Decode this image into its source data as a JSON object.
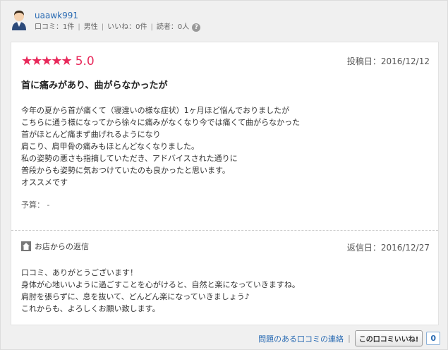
{
  "reviewer": {
    "name": "uaawk991",
    "stats": [
      "口コミ：1件",
      "男性",
      "いいね：0件",
      "読者：0人"
    ]
  },
  "review": {
    "stars": "★★★★★",
    "rating": "5.0",
    "post_date": "投稿日：2016/12/12",
    "title": "首に痛みがあり、曲がらなかったが",
    "body": [
      "今年の夏から首が痛くて（寝違いの様な症状）1ヶ月ほど悩んでおりましたが",
      "こちらに通う様になってから徐々に痛みがなくなり今では痛くて曲がらなかった",
      "首がほとんど痛まず曲げれるようになり",
      "肩こり、肩甲骨の痛みもほとんどなくなりました。",
      "私の姿勢の悪さも指摘していただき、アドバイスされた通りに",
      "普段からも姿勢に気おつけていたのも良かったと思います。",
      "オススメです"
    ],
    "budget_label": "予算：",
    "budget_value": "-"
  },
  "reply": {
    "label": "お店からの返信",
    "date": "返信日：2016/12/27",
    "body": [
      "口コミ、ありがとうございます！",
      "身体が心地いいように過ごすことを心がけると、自然と楽になっていきますね。",
      "肩肘を張らずに、息を抜いて、どんどん楽になっていきましょう♪",
      "これからも、よろしくお願い致します。"
    ]
  },
  "footer": {
    "report_link": "問題のある口コミの連絡",
    "like_button": "この口コミいいね!",
    "like_count": "0"
  },
  "colors": {
    "accent": "#e8285a",
    "link": "#2a6bb3"
  },
  "icons": {
    "avatar": "avatar-icon",
    "help": "help-icon",
    "house": "house-icon"
  }
}
